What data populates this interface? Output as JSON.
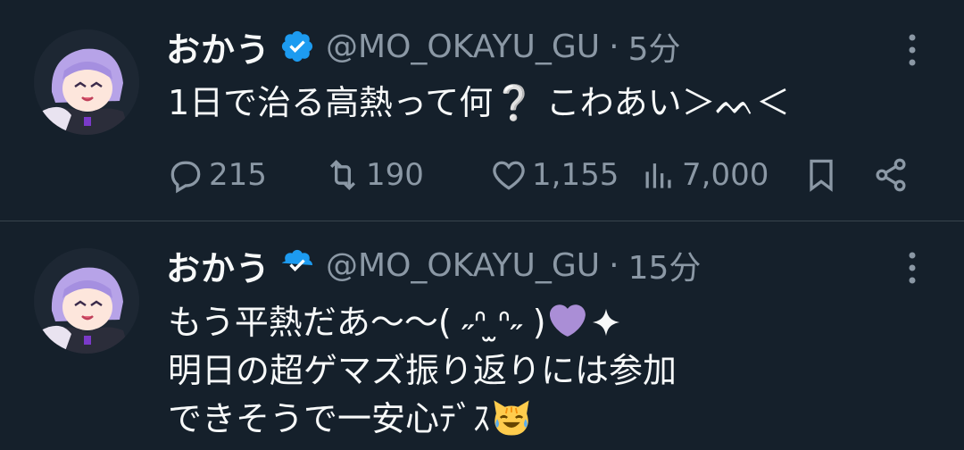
{
  "tweets": [
    {
      "author_name": "おかう",
      "handle": "@MO_OKAYU_GU",
      "separator": "·",
      "time": "5分",
      "lines": [
        "1日で治る高熱って何❔ こわあい＞ᨓ＜"
      ],
      "stats": {
        "replies": "215",
        "retweets": "190",
        "likes": "1,155",
        "views": "7,000"
      }
    },
    {
      "author_name": "おかう",
      "handle": "@MO_OKAYU_GU",
      "separator": "·",
      "time": "15分",
      "lines": [
        "もう平熱だあ〜〜( ˶ᐢ ̫ᐢ˶ )",
        "明日の超ゲマズ振り返りには参加",
        "できそうで一安心ﾃﾞｽ"
      ],
      "emojis": [
        "purple-heart",
        "sparkle",
        "cat-with-tears-of-joy"
      ]
    }
  ],
  "colors": {
    "background": "#15202b",
    "text": "#f7f9f9",
    "muted": "#8b98a5",
    "verified": "#1d9bf0",
    "divider": "#38444d"
  }
}
